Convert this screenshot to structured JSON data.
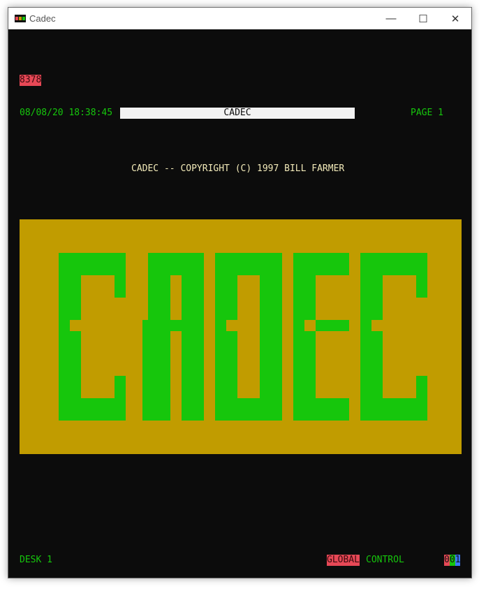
{
  "window": {
    "title": "Cadec",
    "controls": {
      "minimize": "—",
      "maximize": "☐",
      "close": "✕"
    }
  },
  "screen": {
    "job_number": "8378",
    "datetime": "08/08/20 18:38:45",
    "title_bar_text": "CADEC",
    "page": "PAGE 1",
    "copyright": "CADEC -- COPYRIGHT (C) 1997 BILL FARMER",
    "logo_text": "CADEC",
    "status": {
      "desk": "DESK 1",
      "global": "GLOBAL",
      "control": "CONTROL",
      "counter_digits": [
        "0",
        "0",
        "1"
      ]
    }
  },
  "colors": {
    "terminal_bg": "#0c0c0c",
    "text_green": "#16c60c",
    "text_cream": "#f1e9b8",
    "badge_red": "#e74856",
    "logo_panel": "#c19c00",
    "logo_letters": "#16c60c",
    "counter_blue": "#3b78ff"
  },
  "icons": [
    "app-icon",
    "minimize-icon",
    "maximize-icon",
    "close-icon"
  ]
}
